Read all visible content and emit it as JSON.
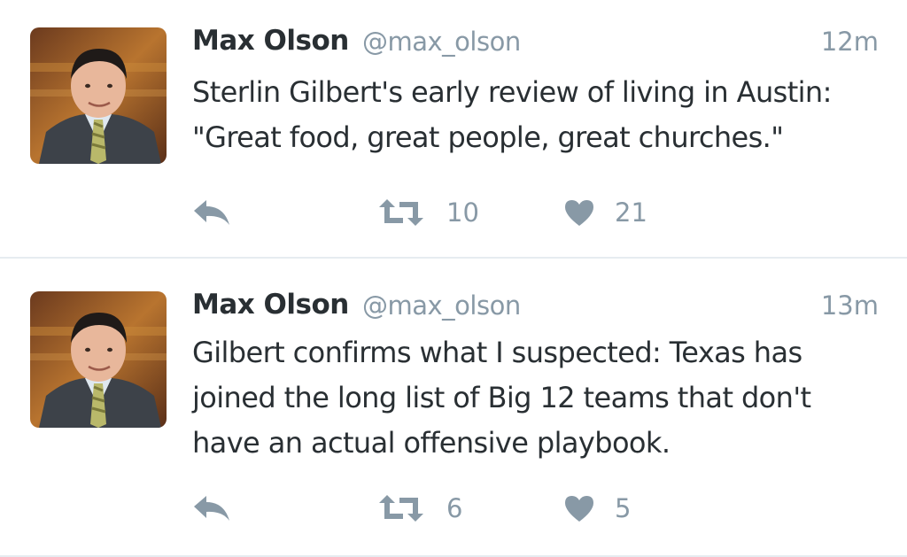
{
  "colors": {
    "text": "#292f33",
    "secondary": "#8899a6",
    "divider": "#e6ecf0",
    "background": "#ffffff"
  },
  "tweets": [
    {
      "author_name": "Max Olson",
      "handle": "@max_olson",
      "time": "12m",
      "text_lines": [
        "Sterlin Gilbert's early review of living in Austin:",
        "\"Great food, great people, great churches.\""
      ],
      "retweets": "10",
      "likes": "21",
      "icons": {
        "reply": "reply-icon",
        "retweet": "retweet-icon",
        "like": "heart-icon"
      }
    },
    {
      "author_name": "Max Olson",
      "handle": "@max_olson",
      "time": "13m",
      "text_lines": [
        "Gilbert confirms what I suspected: Texas has",
        "joined the long list of Big 12 teams that don't",
        "have an actual offensive playbook."
      ],
      "retweets": "6",
      "likes": "5",
      "icons": {
        "reply": "reply-icon",
        "retweet": "retweet-icon",
        "like": "heart-icon"
      }
    }
  ]
}
